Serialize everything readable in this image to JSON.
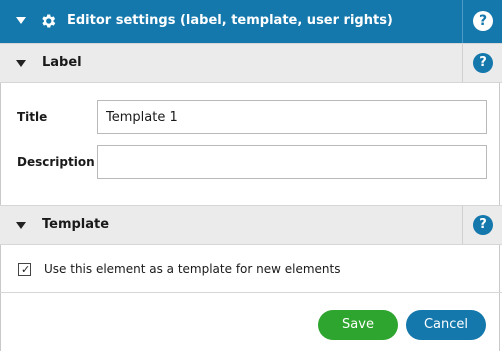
{
  "header": {
    "title": "Editor settings (label, template, user rights)",
    "help_label": "?"
  },
  "label_section": {
    "title": "Label",
    "help_label": "?",
    "fields": {
      "title_label": "Title",
      "title_value": "Template 1",
      "description_label": "Description",
      "description_value": ""
    }
  },
  "template_section": {
    "title": "Template",
    "help_label": "?",
    "checkbox_label": "Use this element as a template for new elements",
    "checkbox_checked": true,
    "checkbox_mark": "✓"
  },
  "actions": {
    "save_label": "Save",
    "cancel_label": "Cancel"
  },
  "colors": {
    "header_bg": "#1478ad",
    "section_bg": "#ebebeb",
    "save": "#2ea52e",
    "cancel": "#1478ad"
  }
}
